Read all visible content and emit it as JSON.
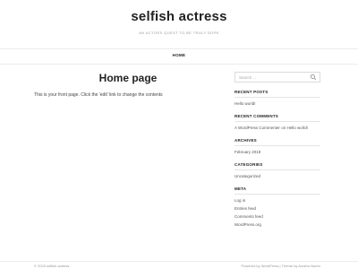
{
  "site": {
    "title": "selfish actress",
    "tagline": "AN ACTORS QUEST TO BE TRULY DOPE"
  },
  "nav": {
    "home_label": "HOME"
  },
  "page": {
    "title": "Home page",
    "body": "This is your front page. Click the 'edit' link to change the contents"
  },
  "sidebar": {
    "search_placeholder": "Search ...",
    "recent_posts": {
      "title": "RECENT POSTS",
      "items": [
        "Hello world!"
      ]
    },
    "recent_comments": {
      "title": "RECENT COMMENTS",
      "author": "A WordPress Commenter",
      "on": "on",
      "post": "Hello world!"
    },
    "archives": {
      "title": "ARCHIVES",
      "items": [
        "February 2019"
      ]
    },
    "categories": {
      "title": "CATEGORIES",
      "items": [
        "Uncategorized"
      ]
    },
    "meta": {
      "title": "META",
      "items": [
        "Log in",
        "Entries feed",
        "Comments feed",
        "WordPress.org"
      ]
    }
  },
  "footer": {
    "left": "© 2025 selfish actress",
    "right": "Powered by WordPress  |  Theme by Anders Norén"
  }
}
